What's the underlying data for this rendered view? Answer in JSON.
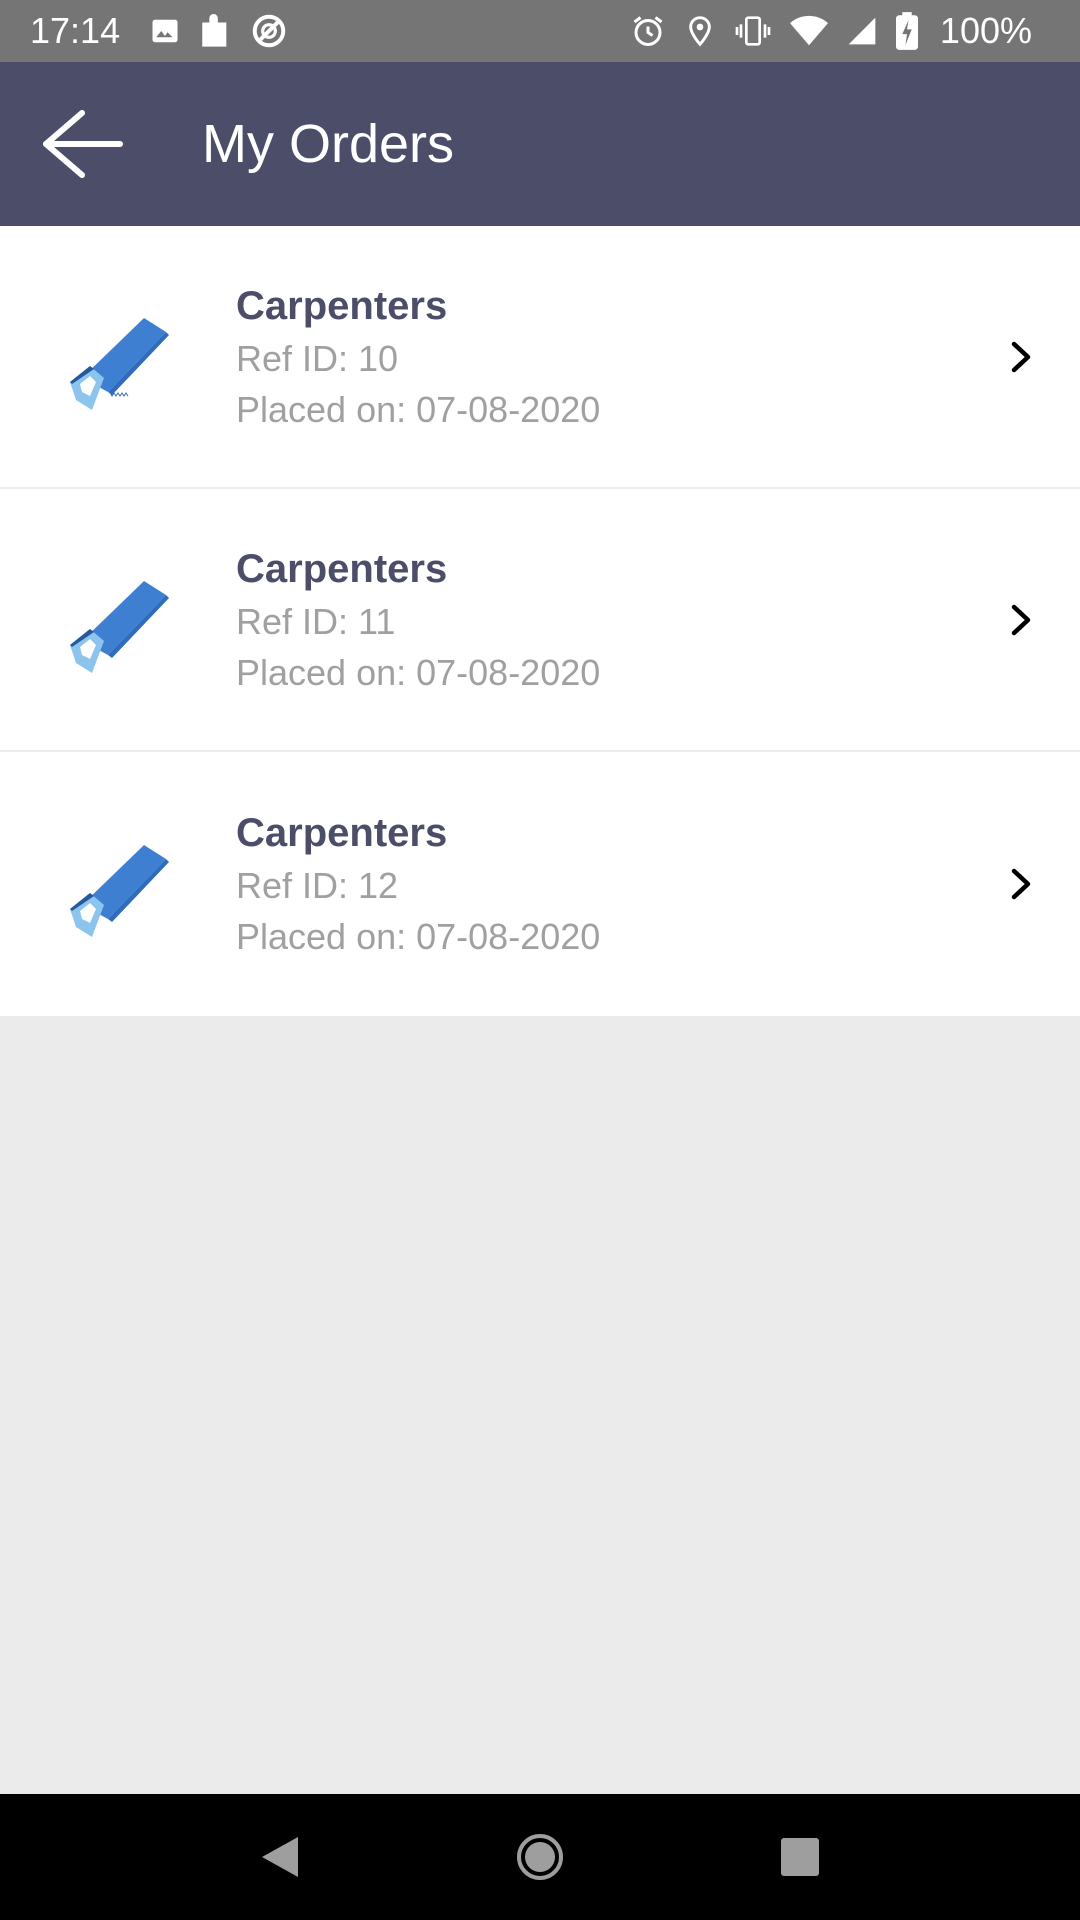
{
  "status_bar": {
    "time": "17:14",
    "battery_text": "100%",
    "left_icons": [
      "image-icon",
      "puzzle-icon",
      "no-disturb-icon"
    ],
    "right_icons": [
      "alarm-icon",
      "location-icon",
      "vibrate-icon",
      "wifi-icon",
      "signal-icon",
      "battery-charging-icon"
    ]
  },
  "app_bar": {
    "title": "My Orders",
    "back_icon": "arrow-back-icon",
    "background_color": "#4c4d69"
  },
  "orders": [
    {
      "title": "Carpenters",
      "ref": "Ref ID: 10",
      "placed": "Placed on: 07-08-2020",
      "icon": "saw-icon"
    },
    {
      "title": "Carpenters",
      "ref": "Ref ID: 11",
      "placed": "Placed on: 07-08-2020",
      "icon": "saw-icon"
    },
    {
      "title": "Carpenters",
      "ref": "Ref ID: 12",
      "placed": "Placed on: 07-08-2020",
      "icon": "saw-icon"
    }
  ],
  "nav_bar": {
    "buttons": [
      "back-triangle-icon",
      "home-circle-icon",
      "recents-square-icon"
    ]
  },
  "colors": {
    "accent_dark": "#4c4d69",
    "saw_blue": "#3f7fd2",
    "saw_handle": "#8cc4ee",
    "muted_text": "#a0a0a0",
    "background": "#ebebeb"
  }
}
